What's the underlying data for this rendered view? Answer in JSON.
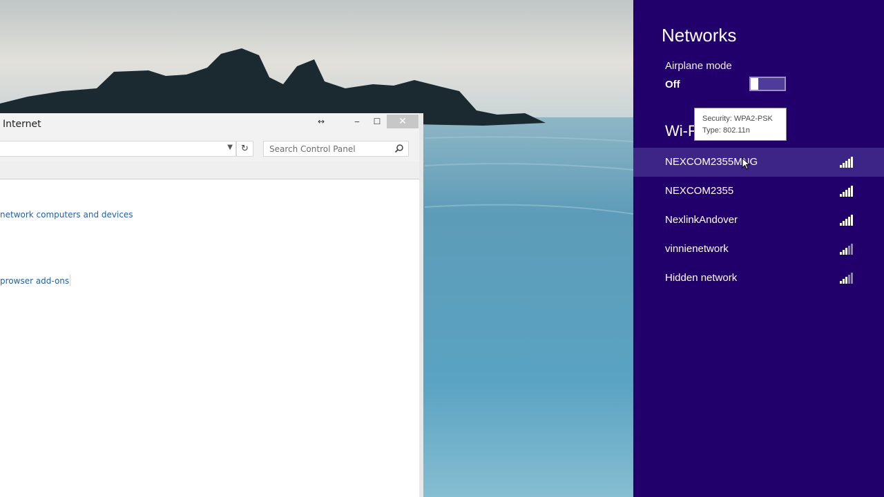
{
  "window": {
    "title": "Internet",
    "search_placeholder": "Search Control Panel",
    "links": [
      "network computers and devices",
      "prowser add-ons"
    ]
  },
  "networks_panel": {
    "title": "Networks",
    "airplane_mode": {
      "label": "Airplane mode",
      "state": "Off",
      "enabled": false
    },
    "wifi_heading": "Wi-Fi",
    "networks": [
      {
        "name": "NEXCOM2355MNG",
        "signal_bars": 5,
        "highlighted": true
      },
      {
        "name": "NEXCOM2355",
        "signal_bars": 5,
        "highlighted": false
      },
      {
        "name": "NexlinkAndover",
        "signal_bars": 5,
        "highlighted": false
      },
      {
        "name": "vinnienetwork",
        "signal_bars": 3,
        "highlighted": false
      },
      {
        "name": "Hidden network",
        "signal_bars": 3,
        "highlighted": false
      }
    ],
    "tooltip": {
      "line1": "Security: WPA2-PSK",
      "line2": "Type: 802.11n"
    }
  },
  "colors": {
    "panel_bg": "#22006b",
    "hover_bg": "#3d2487",
    "link": "#1e5fb3"
  }
}
